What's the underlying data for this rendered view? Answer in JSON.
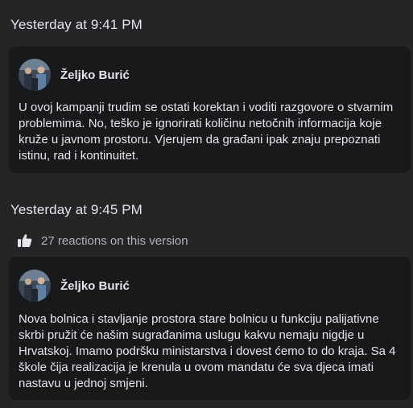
{
  "versions": [
    {
      "timestamp": "Yesterday at 9:41 PM",
      "author": "Željko Burić",
      "text": "U ovoj kampanji trudim se ostati korektan i voditi razgovore o stvarnim problemima. No, teško je ignorirati količinu netočnih informacija koje kruže u javnom prostoru. Vjerujem da građani ipak znaju prepoznati istinu, rad i kontinuitet."
    },
    {
      "timestamp": "Yesterday at 9:45 PM",
      "reactions": "27 reactions on this version",
      "author": "Željko Burić",
      "text": "Nova bolnica i stavljanje prostora stare bolnicu u funkciju palijativne skrbi pružit će našim sugrađanima uslugu kakvu nemaju nigdje u Hrvatskoj. Imamo podršku ministarstva i dovest ćemo to do kraja. Sa 4 škole čija realizacija je krenula u ovom mandatu će sva djeca imati nastavu u jednoj smjeni."
    }
  ],
  "icons": {
    "reaction": "thumbs-up-icon"
  }
}
